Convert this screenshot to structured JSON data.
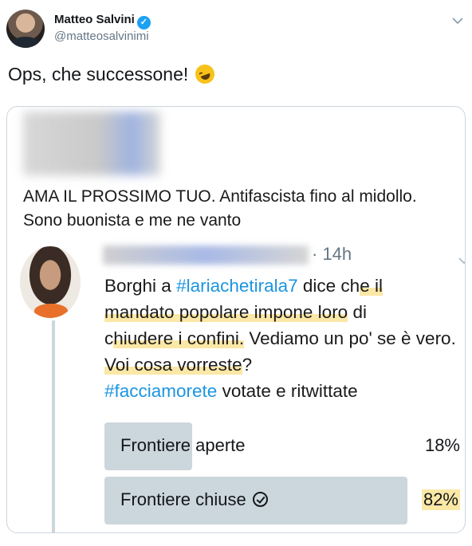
{
  "author": {
    "name": "Matteo Salvini",
    "handle": "@matteosalvinimi",
    "verified_icon": "verified-badge-icon"
  },
  "tweet": {
    "text": "Ops, che successone!",
    "emoji": "rolling-on-floor-laughing-emoji"
  },
  "embedded": {
    "bio": "AMA IL PROSSIMO TUO. Antifascista fino al midollo. Sono buonista e me ne vanto",
    "time": "· 14h",
    "quote": {
      "p1": "Borghi a ",
      "hashtag1": "#lariachetirala7",
      "p2": " dice ch",
      "h1": "e il",
      "h2": "mandato popolare impone loro",
      "p3": " di ",
      "p4": "c",
      "h3": "hiudere i confini.",
      "p5": " Vediamo un po' se è vero. ",
      "h4": "Voi cosa vorreste",
      "p6": "?",
      "hashtag2": "#facciamorete",
      "p7": " votate e ritwittate"
    },
    "poll": {
      "options": [
        {
          "label": "Frontiere aperte",
          "percent_label": "18%",
          "value": 0.18,
          "selected": false
        },
        {
          "label": "Frontiere chiuse",
          "percent_label": "82%",
          "value": 0.82,
          "selected": true
        }
      ]
    }
  },
  "colors": {
    "link": "#1b95e0",
    "highlight": "#fbe7a6",
    "poll_bar": "#ccd6dd",
    "verified": "#1da1f2"
  }
}
